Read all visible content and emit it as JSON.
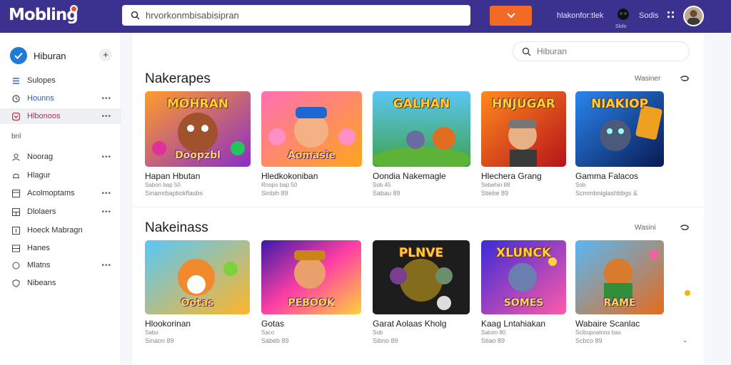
{
  "app": {
    "logo_text": "Mobling"
  },
  "topbar": {
    "search_placeholder": "hrvorkonmbisabisipran",
    "link1": "hlakonfor:tlek",
    "icon_caption": "Slolo",
    "link2": "Sodis"
  },
  "sidebar": {
    "title": "Hiburan",
    "plus_label": "+",
    "items_top": [
      {
        "label": "Sulopes",
        "icon": "doc-icon",
        "dots": ""
      },
      {
        "label": "Hounns",
        "icon": "clock-icon",
        "dots": "•••"
      },
      {
        "label": "Hlbonoos",
        "icon": "heart-icon",
        "dots": "•••",
        "active": true
      }
    ],
    "section_label": "bnl",
    "items_bottom": [
      {
        "label": "Noorag",
        "icon": "user-icon",
        "dots": "•••"
      },
      {
        "label": "Hlagur",
        "icon": "bell-icon",
        "dots": ""
      },
      {
        "label": "Acolmoptams",
        "icon": "list-icon",
        "dots": "•••"
      },
      {
        "label": "Dlolaers",
        "icon": "grid-icon",
        "dots": "•••"
      },
      {
        "label": "Hoeck Mabragn",
        "icon": "card-icon",
        "dots": ""
      },
      {
        "label": "Hanes",
        "icon": "menu-icon",
        "dots": ""
      },
      {
        "label": "Mlatns",
        "icon": "circle-icon",
        "dots": "•••"
      },
      {
        "label": "Nibeans",
        "icon": "shield-icon",
        "dots": ""
      }
    ]
  },
  "filter": {
    "placeholder": "Hiburan"
  },
  "sections": [
    {
      "title": "Nakerapes",
      "link": "Wasiner",
      "cards": [
        {
          "title": "Hapan Hbutan",
          "sub": "Sabon  bap 50",
          "meta": "Sinamrbaptiokflasbs",
          "thumb_top": "MOHRAN",
          "thumb_bottom": "Doopzbl",
          "colors": [
            "#ff8a1f",
            "#7b2fbf"
          ]
        },
        {
          "title": "Hledkokoniban",
          "sub": "Rnopo  bap 50",
          "meta": "Sinbih  89",
          "thumb_top": "",
          "thumb_bottom": "Aomasie",
          "colors": [
            "#f56fb0",
            "#ff9f1c"
          ]
        },
        {
          "title": "Oondia Nakemagle",
          "sub": "Sob  45",
          "meta": "Sabau  89",
          "thumb_top": "GALHAN",
          "thumb_bottom": "",
          "colors": [
            "#5ac8f5",
            "#4caf50"
          ]
        },
        {
          "title": "Hlechera Grang",
          "sub": "Sebehin  88",
          "meta": "Stiebe  89",
          "thumb_top": "HNJUGAR",
          "thumb_bottom": "",
          "colors": [
            "#ff7a1a",
            "#c4161c"
          ]
        },
        {
          "title": "Gamma Falacos",
          "sub": "Sob",
          "meta": "Scmmbniglashbbgs  &",
          "thumb_top": "NIAKIOP",
          "thumb_bottom": "",
          "colors": [
            "#1f6fd8",
            "#0b1c5c"
          ]
        }
      ]
    },
    {
      "title": "Nakeinass",
      "link": "Wasini",
      "cards": [
        {
          "title": "Hlookorinan",
          "sub": "Sabo",
          "meta": "Sinaon  89",
          "thumb_top": "",
          "thumb_bottom": "Ootas",
          "colors": [
            "#4cc3f5",
            "#ffb020"
          ]
        },
        {
          "title": "Gotas",
          "sub": "Saco",
          "meta": "Sabeb  89",
          "thumb_top": "",
          "thumb_bottom": "PEBOOK",
          "colors": [
            "#3b1aa8",
            "#ff3fa4"
          ]
        },
        {
          "title": "Garat Aolaas Kholg",
          "sub": "Sob",
          "meta": "Sibno  89",
          "thumb_top": "PLNVE",
          "thumb_bottom": "",
          "colors": [
            "#1b1b1b",
            "#c8a11b"
          ]
        },
        {
          "title": "Kaag Lntahiakan",
          "sub": "Satom  80",
          "meta": "Stiao  89",
          "thumb_top": "XLUNCK",
          "thumb_bottom": "SOMES",
          "colors": [
            "#3b2ad8",
            "#ff5aa8"
          ]
        },
        {
          "title": "Wabaire Scanlac",
          "sub": "Scibopoatnos  bas",
          "meta": "Scbco  89",
          "thumb_top": "",
          "thumb_bottom": "RAME",
          "colors": [
            "#57b8f5",
            "#e66b1c"
          ]
        }
      ]
    }
  ],
  "colors": {
    "topbar": "#3b318f",
    "accent_orange": "#f36a26",
    "active_text": "#c32c39",
    "check_blue": "#1e7bd8"
  }
}
